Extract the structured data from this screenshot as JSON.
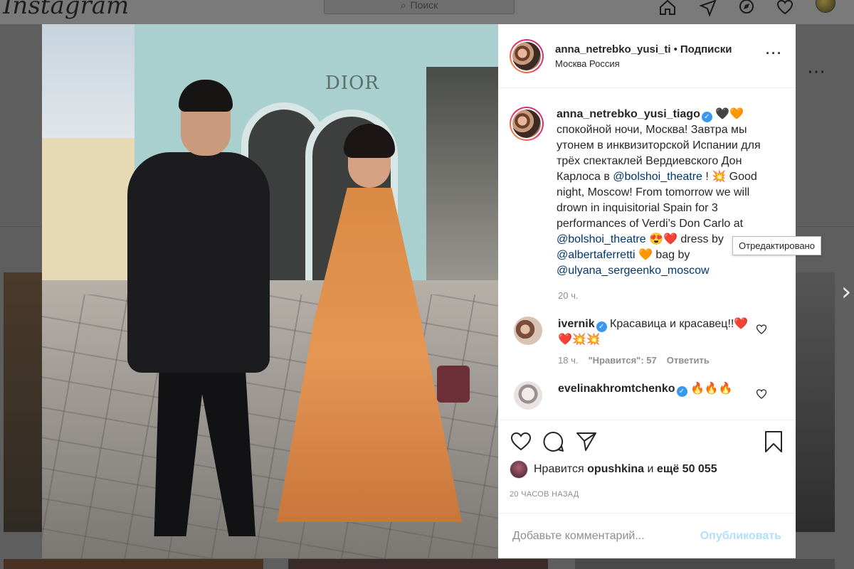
{
  "background": {
    "logo": "Instagram",
    "search_placeholder": "Поиск"
  },
  "post": {
    "username": "anna_netrebko_yusi_ti",
    "separator": "•",
    "follow_label": "Подписки",
    "location": "Москва Россия",
    "more": "•••"
  },
  "caption": {
    "username": "anna_netrebko_yusi_tiago",
    "emoji_after_name": "🖤🧡",
    "text_1": "спокойной ночи, Москва! Завтра мы утонем в инквизиторской Испании для трёх спектаклей Вердиевского Дон Карлоса в ",
    "mention_1": "@bolshoi_theatre",
    "text_2": " ! 💥 Good night, Moscow! From tomorrow we will drown in inquisitorial Spain for 3 performances of Verdi’s Don Carlo at ",
    "mention_2": "@bolshoi_theatre",
    "text_3": " 😍❤️ dress by ",
    "mention_3": "@albertaferretti",
    "text_4": " 🧡 bag by ",
    "mention_4": "@ulyana_sergeenko_moscow",
    "time": "20 ч."
  },
  "tooltip": "Отредактировано",
  "comments": [
    {
      "username": "ivernik",
      "text": "Красавица и красавец!!❤️❤️💥💥",
      "time": "18 ч.",
      "likes": "\"Нравится\": 57",
      "reply": "Ответить"
    },
    {
      "username": "evelinakhromtchenko",
      "text": "🔥🔥🔥"
    }
  ],
  "likes": {
    "prefix": "Нравится",
    "user": "opushkina",
    "middle": "и",
    "count": "ещё 50 055"
  },
  "post_time": "20 ЧАСОВ НАЗАД",
  "add_comment": {
    "placeholder": "Добавьте комментарий...",
    "publish": "Опубликовать"
  },
  "colors": {
    "link": "#00376b",
    "verified": "#3897f0",
    "publish_disabled": "#b2dffc",
    "meta": "#8e8e8e"
  }
}
